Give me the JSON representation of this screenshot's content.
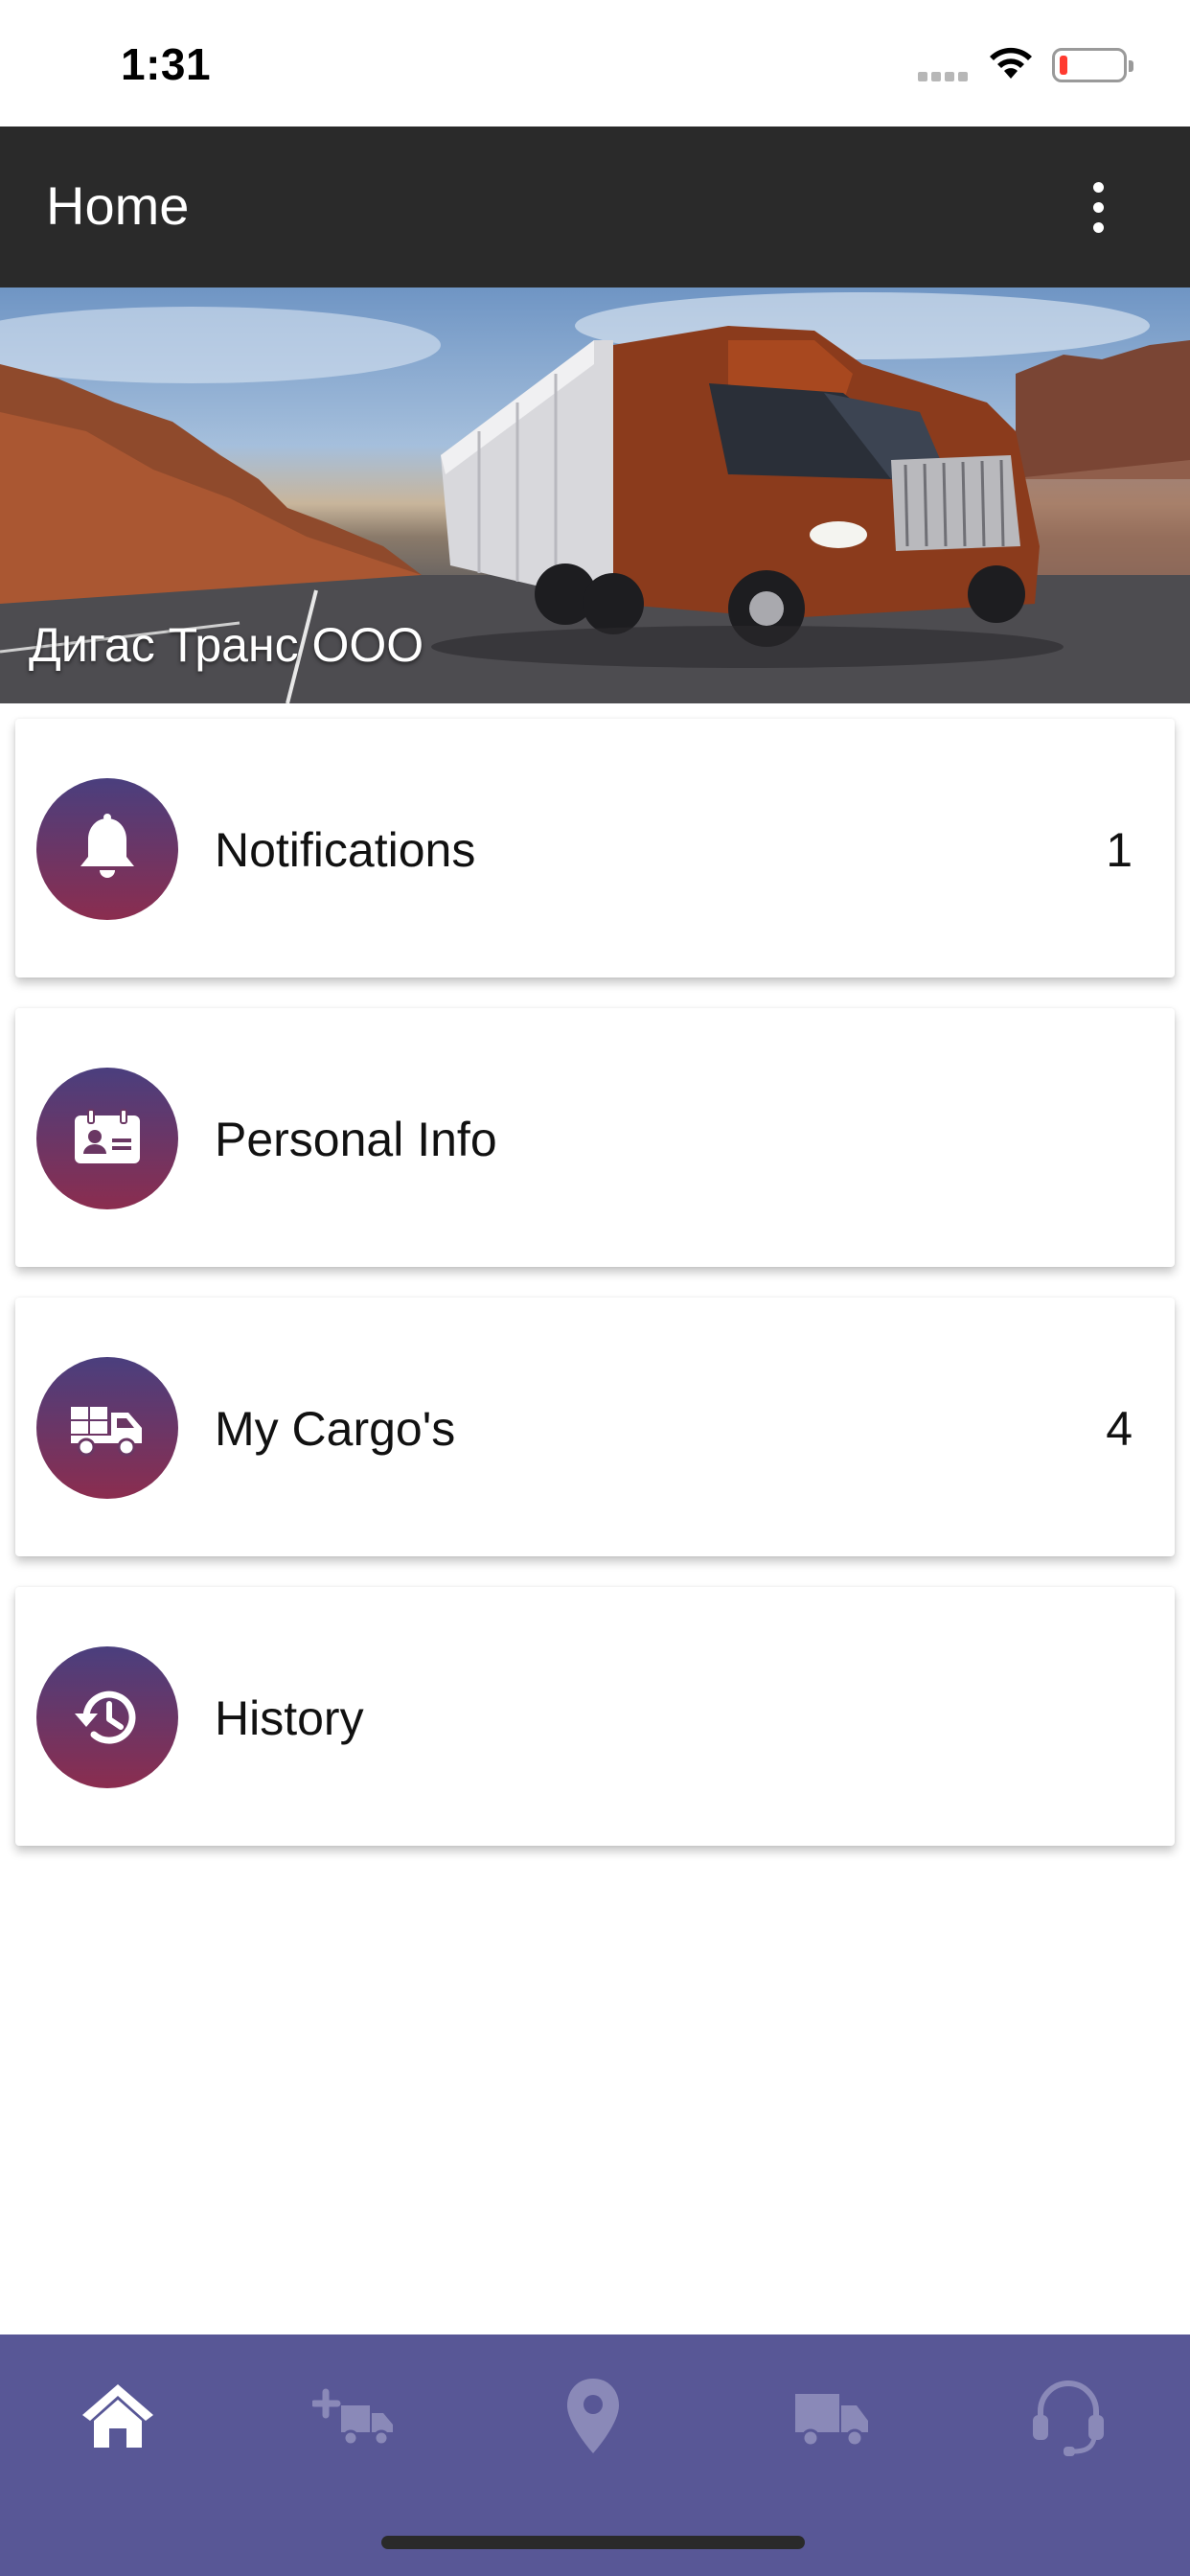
{
  "status_bar": {
    "time": "1:31"
  },
  "app_bar": {
    "title": "Home"
  },
  "banner": {
    "company_name": "Дигас Транс ООО"
  },
  "menu": [
    {
      "label": "Notifications",
      "count": "1",
      "icon": "bell-icon"
    },
    {
      "label": "Personal Info",
      "count": "",
      "icon": "id-card-icon"
    },
    {
      "label": "My Cargo's",
      "count": "4",
      "icon": "cargo-truck-icon"
    },
    {
      "label": "History",
      "count": "",
      "icon": "history-icon"
    }
  ],
  "bottom_nav": [
    {
      "icon": "home-icon",
      "active": true
    },
    {
      "icon": "add-truck-icon",
      "active": false
    },
    {
      "icon": "location-pin-icon",
      "active": false
    },
    {
      "icon": "truck-icon",
      "active": false
    },
    {
      "icon": "headset-icon",
      "active": false
    }
  ],
  "colors": {
    "app_bar": "#2a2a2a",
    "bottom_nav": "#585796",
    "icon_gradient_top": "#4a3f7e",
    "icon_gradient_bottom": "#8b2d4f",
    "nav_inactive": "#8a89b8"
  }
}
